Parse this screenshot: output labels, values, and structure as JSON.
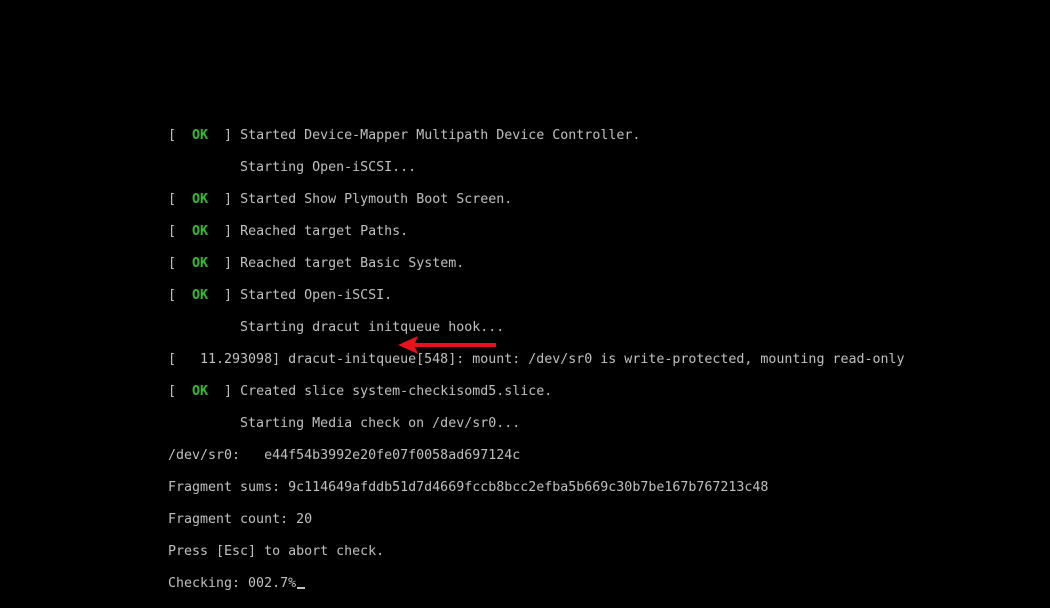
{
  "colors": {
    "background": "#000000",
    "text": "#c0c0c0",
    "ok": "#2fbf2f",
    "arrow": "#e8131a"
  },
  "status": {
    "open": "[ ",
    "ok": " OK ",
    "close": " ] "
  },
  "console": {
    "lines": [
      {
        "type": "ok",
        "text": "Started Device-Mapper Multipath Device Controller."
      },
      {
        "type": "plain",
        "text": "         Starting Open-iSCSI..."
      },
      {
        "type": "ok",
        "text": "Started Show Plymouth Boot Screen."
      },
      {
        "type": "ok",
        "text": "Reached target Paths."
      },
      {
        "type": "ok",
        "text": "Reached target Basic System."
      },
      {
        "type": "ok",
        "text": "Started Open-iSCSI."
      },
      {
        "type": "plain",
        "text": "         Starting dracut initqueue hook..."
      },
      {
        "type": "plain",
        "text": "[   11.293098] dracut-initqueue[548]: mount: /dev/sr0 is write-protected, mounting read-only"
      },
      {
        "type": "ok",
        "text": "Created slice system-checkisomd5.slice."
      },
      {
        "type": "plain",
        "text": "         Starting Media check on /dev/sr0..."
      },
      {
        "type": "plain",
        "text": "/dev/sr0:   e44f54b3992e20fe07f0058ad697124c"
      },
      {
        "type": "plain",
        "text": "Fragment sums: 9c114649afddb51d7d4669fccb8bcc2efba5b669c30b7be167b767213c48"
      },
      {
        "type": "plain",
        "text": "Fragment count: 20"
      },
      {
        "type": "plain",
        "text": "Press [Esc] to abort check."
      },
      {
        "type": "plain",
        "text": "Checking: 002.7%"
      }
    ]
  },
  "annotation": {
    "icon": "left-arrow-icon"
  }
}
